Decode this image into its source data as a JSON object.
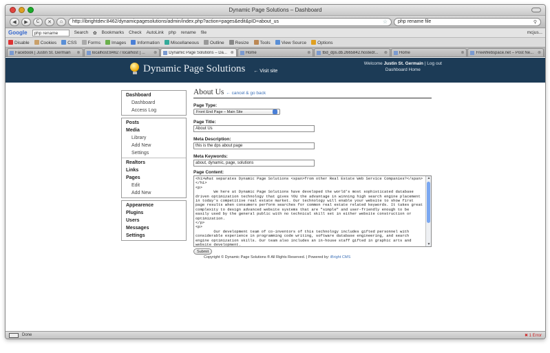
{
  "window": {
    "title": "Dynamic Page Solutions – Dashboard"
  },
  "nav": {
    "back": "◀",
    "forward": "▶",
    "reload": "C",
    "stop": "✕",
    "home": "⌂",
    "url": "http://ibrightdev:8462/dynamicpagesolutions/admin/index.php?action=pages&edit&pID=about_us",
    "search_value": "php rename file"
  },
  "google_toolbar": {
    "logo": "Google",
    "query": "php rename",
    "items": [
      "Search",
      "✿",
      "Bookmarks",
      "Check",
      "AutoLink",
      "php",
      "rename",
      "file"
    ],
    "right": "mcjus..."
  },
  "dev_toolbar": {
    "items": [
      "Disable",
      "Cookies",
      "CSS",
      "Forms",
      "Images",
      "Information",
      "Miscellaneous",
      "Outline",
      "Resize",
      "Tools",
      "View Source",
      "Options"
    ]
  },
  "tabs": [
    {
      "label": "Facebook | Justin St. Germain",
      "active": false
    },
    {
      "label": "localhost:8462 / localhost | ...",
      "active": false
    },
    {
      "label": "Dynamic Page Solutions – Da...",
      "active": true
    },
    {
      "label": "Home",
      "active": false
    },
    {
      "label": "tbd_dps.db.2665842.hostedr...",
      "active": false
    },
    {
      "label": "Home",
      "active": false
    },
    {
      "label": "FreeWebspace.net – Post Ne...",
      "active": false
    }
  ],
  "site": {
    "logo_text": "Dynamic Page Solutions",
    "visit_site": "← Visit site",
    "welcome_prefix": "Welcome ",
    "user": "Justin St. Germain",
    "logout": " | Log out",
    "dashboard_home": "Dashboard Home"
  },
  "sidebar": {
    "groups": [
      {
        "heading": "Dashboard",
        "items": [
          "Dashboard",
          "Access Log"
        ]
      },
      {
        "heading": "Posts",
        "items": []
      },
      {
        "heading": "Media",
        "items": [
          "Library",
          "Add New",
          "Settings"
        ]
      },
      {
        "heading": "Realtors",
        "items": []
      },
      {
        "heading": "Links",
        "items": []
      },
      {
        "heading": "Pages",
        "items": [
          "Edit",
          "Add New"
        ]
      },
      {
        "heading": "Appearence",
        "items": []
      },
      {
        "heading": "Plugins",
        "items": []
      },
      {
        "heading": "Users",
        "items": []
      },
      {
        "heading": "Messages",
        "items": []
      },
      {
        "heading": "Settings",
        "items": []
      }
    ]
  },
  "editor": {
    "page_title": "About Us",
    "cancel_link": "← cancel & go back",
    "page_type_label": "Page Type:",
    "page_type_value": "Front End Page – Main Site",
    "title_label": "Page Title:",
    "title_value": "About Us",
    "meta_desc_label": "Meta Description:",
    "meta_desc_value": "this is the dps about page",
    "meta_kw_label": "Meta Keywords:",
    "meta_kw_value": "about, dynamic, page, solutions",
    "content_label": "Page Content:",
    "content_value": "<h1>What separates Dynamic Page Solutions <span>from other Real Estate Web Service Companies?</span></h1>\n<p>\n        We here at Dynamic Page Solutions have developed the world's most sophisticated database driven optimization technology that gives YOU the advantage in winning high search engine placement in today's competitive real estate market. Our technology will enable your website to show first page results when consumers perform searches for common real estate related keywords. It takes great complexity to design advanced website systems that are \"simple\" and user-friendly enough to be easily used by the general public with no technical skill set in either website construction or optimization.\n</p>\n<p>\n        Our development team of co-inventors of this technology includes gifted personnel with considerable experience in programming code writing, software database engineering, and search engine optimization skills. Our team also includes an in-house staff gifted in graphic arts and website development.\n</p>\n<p>",
    "submit": "Submit",
    "footer_text": "Copyright © Dynamic Page Solutions ® All Rights Reserved. | Powered by: ",
    "footer_link": "iBright CMS"
  },
  "status": {
    "text": "Done",
    "errors": "1 Error"
  }
}
